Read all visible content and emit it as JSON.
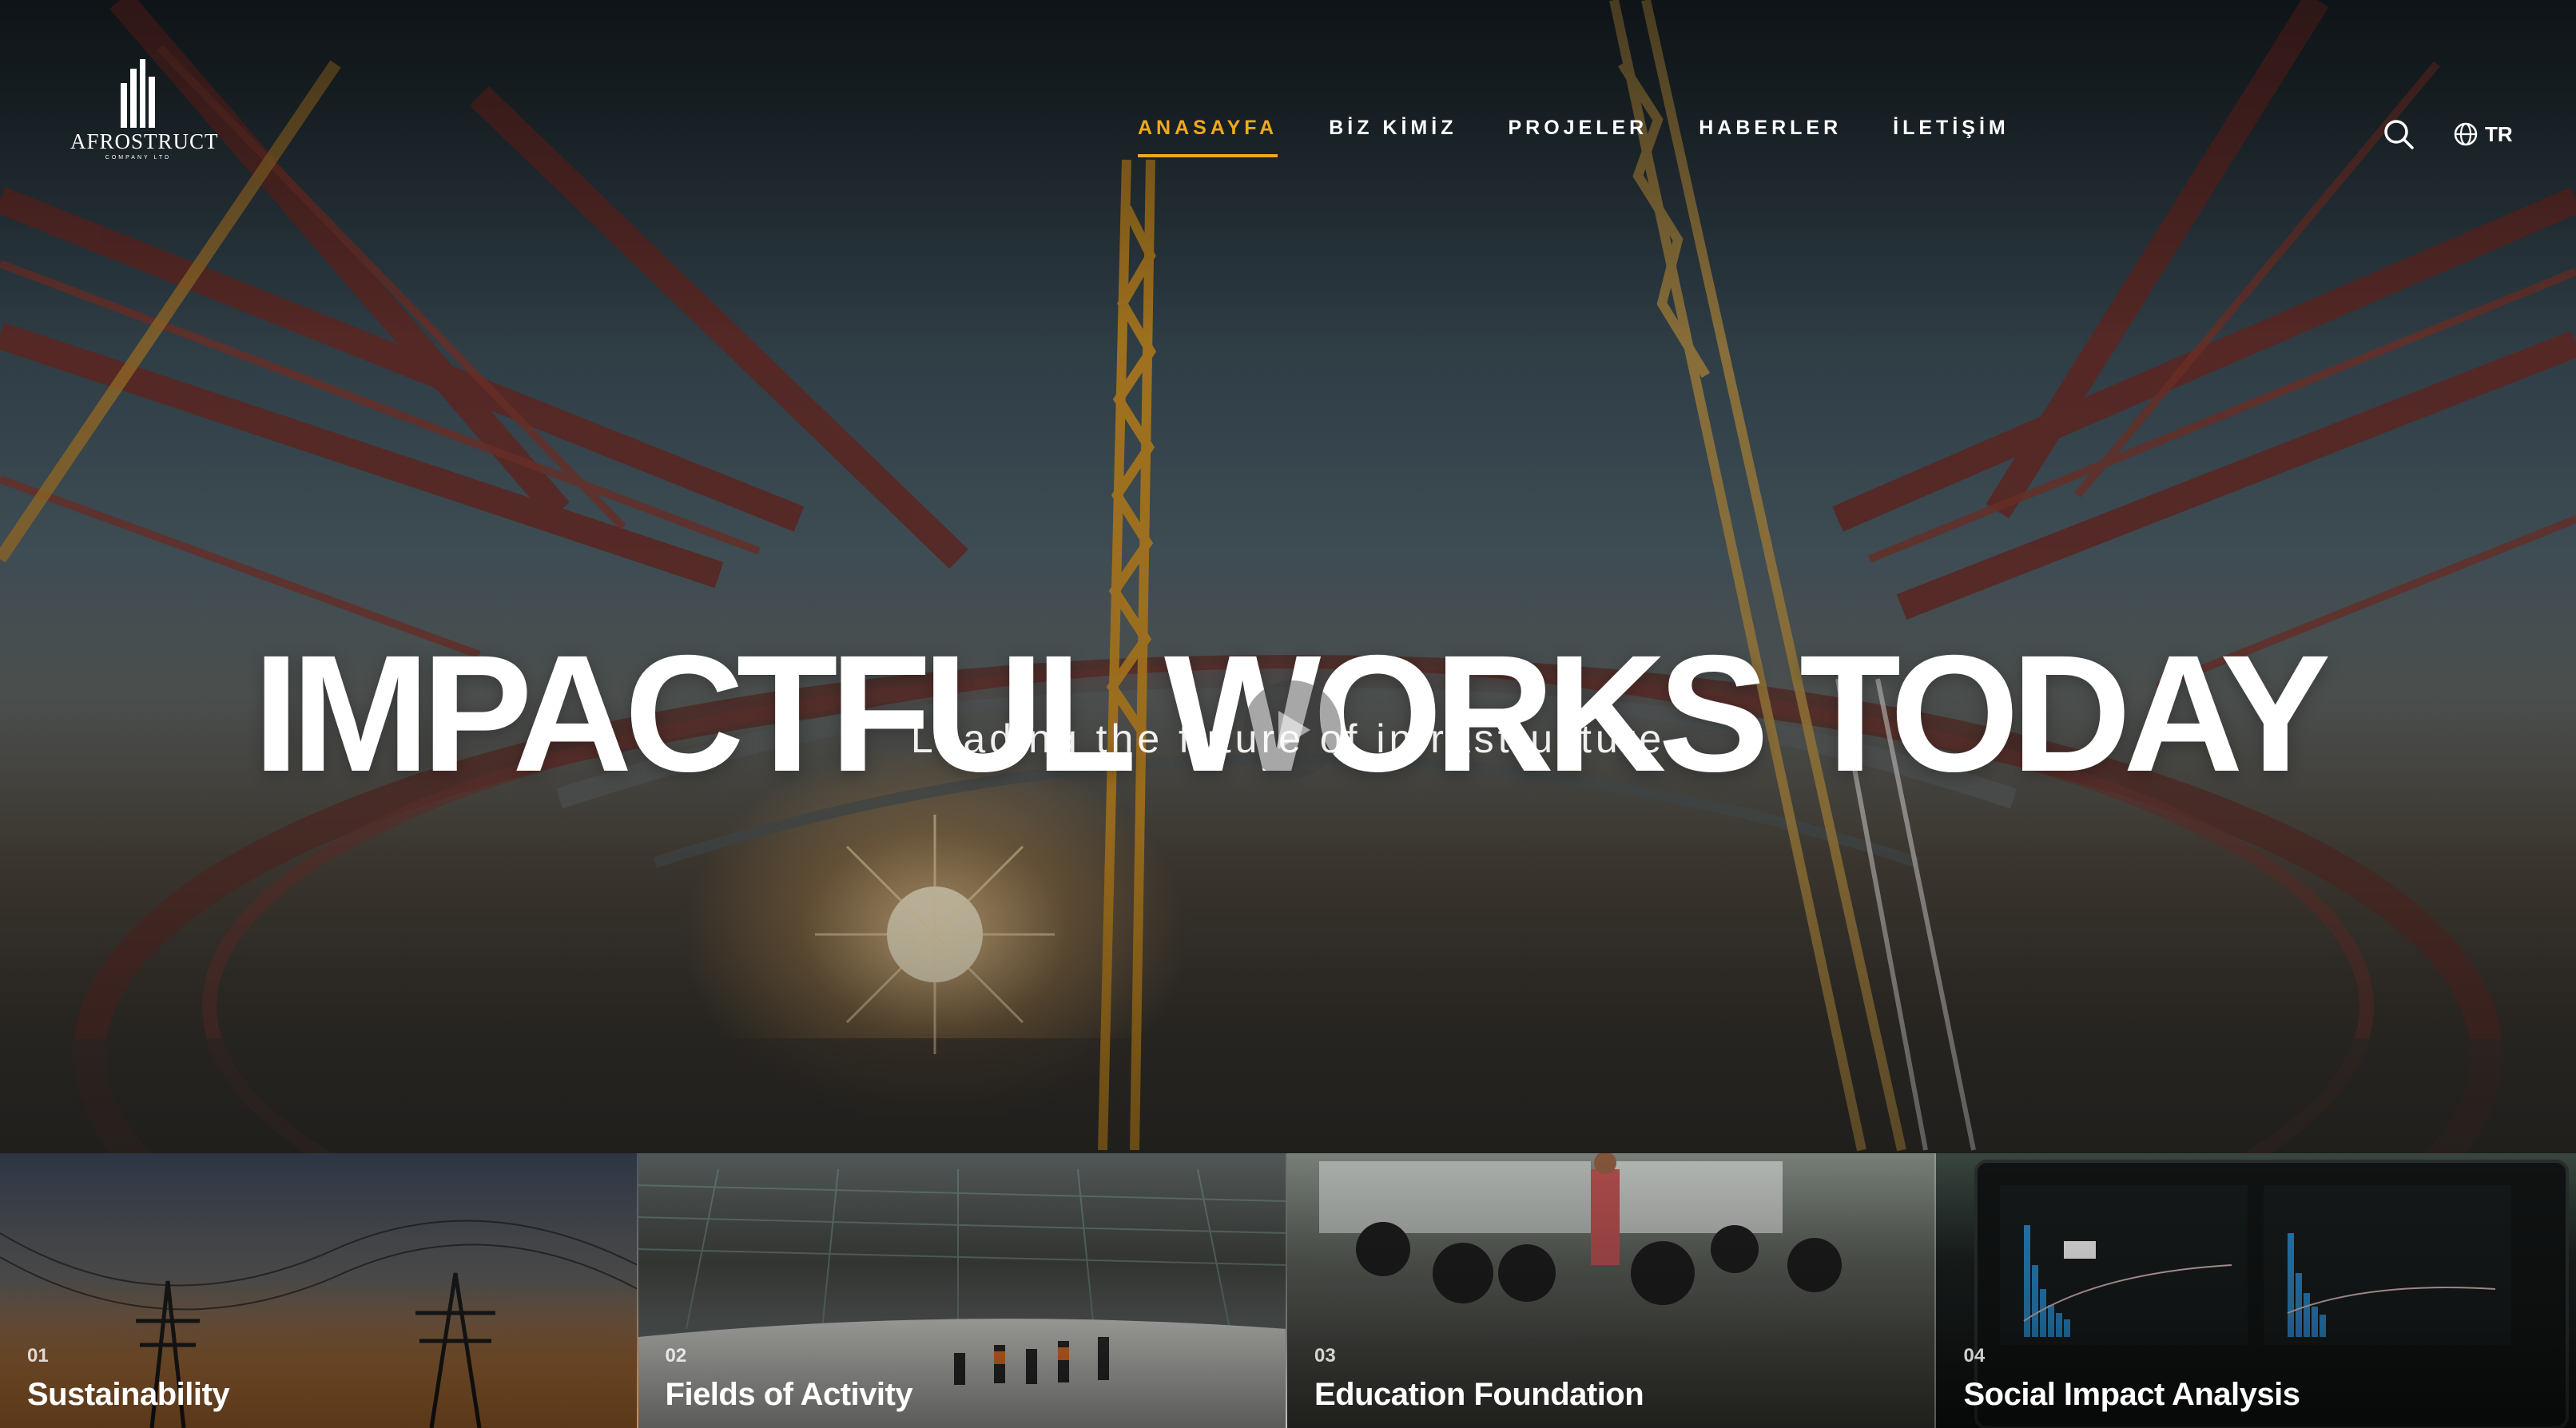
{
  "brand": {
    "name": "AFROSTRUCT",
    "tagline": "COMPANY LTD",
    "logo_icon": "skyscraper-logo-icon"
  },
  "nav": {
    "items": [
      {
        "label": "ANASAYFA",
        "active": true
      },
      {
        "label": "BİZ KİMİZ",
        "active": false
      },
      {
        "label": "PROJELER",
        "active": false
      },
      {
        "label": "HABERLER",
        "active": false
      },
      {
        "label": "İLETİŞİM",
        "active": false
      }
    ],
    "active_color": "#f2a81d"
  },
  "header_actions": {
    "search_icon": "search-icon",
    "language_icon": "globe-icon",
    "language": "TR"
  },
  "hero": {
    "title": "IMPACTFUL WORKS TODAY",
    "subtitle": "Leading the future of infrastructure",
    "play_icon": "play-icon"
  },
  "cards": [
    {
      "number": "01",
      "title": "Sustainability"
    },
    {
      "number": "02",
      "title": "Fields of Activity"
    },
    {
      "number": "03",
      "title": "Education Foundation"
    },
    {
      "number": "04",
      "title": "Social Impact Analysis"
    }
  ]
}
